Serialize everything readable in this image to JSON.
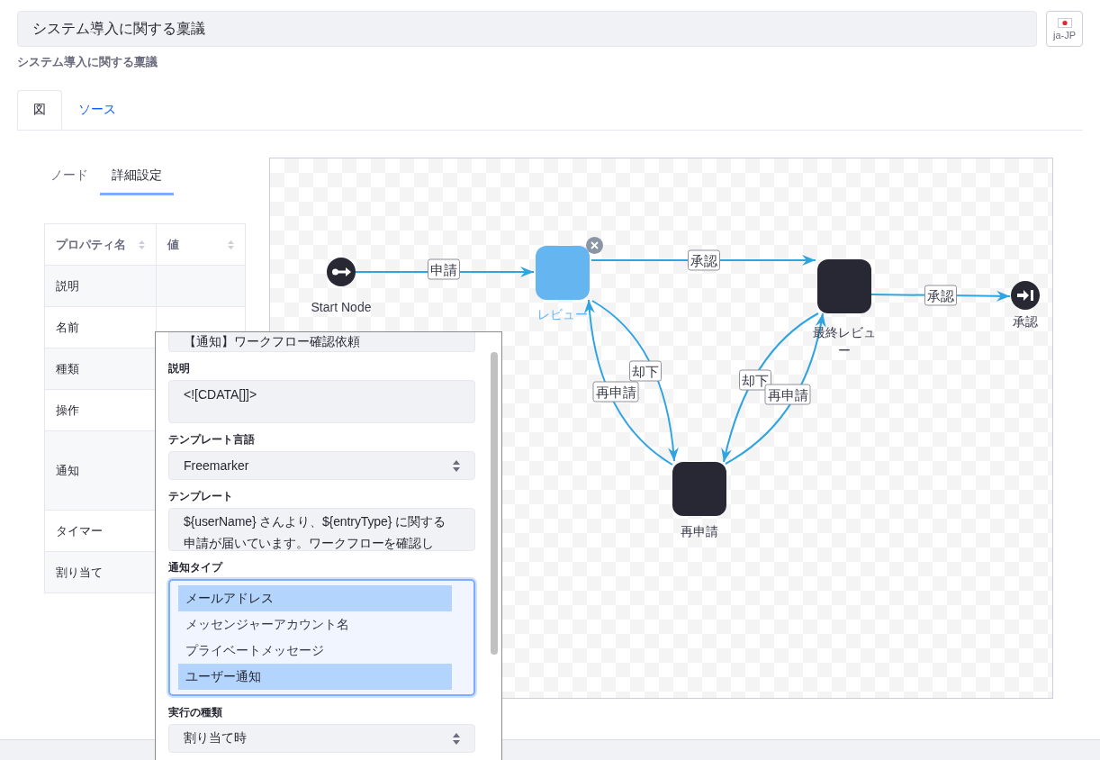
{
  "title_field": {
    "value": "システム導入に関する稟議"
  },
  "language_button": {
    "label": "ja-JP"
  },
  "subtitle": "システム導入に関する稟議",
  "tabs": [
    {
      "label": "図",
      "selected": true
    },
    {
      "label": "ソース",
      "selected": false
    }
  ],
  "panel_tabs": [
    {
      "label": "ノード",
      "selected": false
    },
    {
      "label": "詳細設定",
      "selected": true
    }
  ],
  "property_table": {
    "columns": [
      "プロパティ名",
      "値"
    ],
    "rows": [
      {
        "name": "説明"
      },
      {
        "name": "名前"
      },
      {
        "name": "種類"
      },
      {
        "name": "操作"
      },
      {
        "name": "通知"
      },
      {
        "name": "タイマー"
      },
      {
        "name": "割り当て"
      }
    ]
  },
  "diagram": {
    "nodes": [
      {
        "kind": "start",
        "label": "Start Node",
        "selected": false
      },
      {
        "kind": "task",
        "label": "レビュー",
        "selected": true
      },
      {
        "kind": "task",
        "label": "最終レビュー",
        "selected": false
      },
      {
        "kind": "task",
        "label": "再申請",
        "selected": false
      },
      {
        "kind": "end",
        "label": "承認",
        "selected": false
      }
    ],
    "edges": [
      {
        "label": "申請"
      },
      {
        "label": "承認"
      },
      {
        "label": "承認"
      },
      {
        "label": "却下"
      },
      {
        "label": "再申請"
      },
      {
        "label": "却下"
      },
      {
        "label": "再申請"
      }
    ]
  },
  "notification_editor": {
    "name_value": "【通知】ワークフロー確認依頼",
    "fields": [
      {
        "kind": "textarea",
        "label": "説明",
        "value": "<![CDATA[]]>"
      },
      {
        "kind": "select",
        "label": "テンプレート言語",
        "value": "Freemarker"
      },
      {
        "kind": "textarea",
        "label": "テンプレート",
        "value": "${userName} さんより、${entryType} に関する申請が届いています。ワークフローを確認し"
      },
      {
        "kind": "multiselect",
        "label": "通知タイプ",
        "options": [
          {
            "label": "メールアドレス",
            "selected": true
          },
          {
            "label": "メッセンジャーアカウント名",
            "selected": false
          },
          {
            "label": "プライベートメッセージ",
            "selected": false
          },
          {
            "label": "ユーザー通知",
            "selected": true
          }
        ]
      },
      {
        "kind": "select",
        "label": "実行の種類",
        "value": "割り当て時"
      }
    ]
  }
}
